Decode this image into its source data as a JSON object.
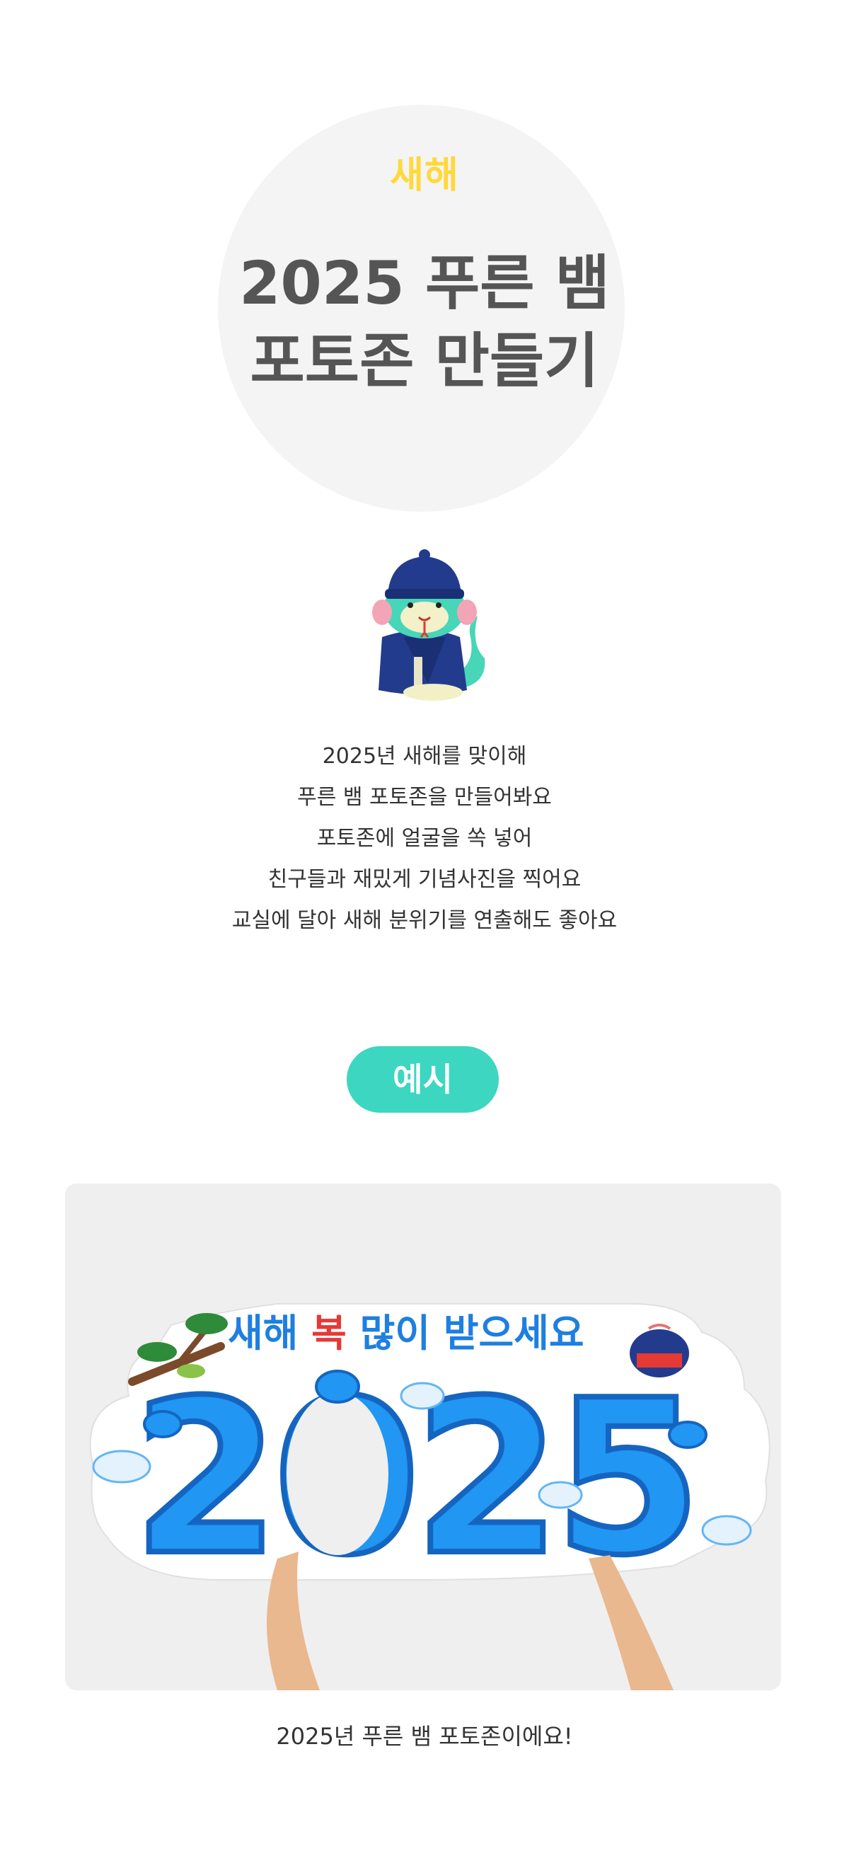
{
  "hero": {
    "eyebrow": "새해",
    "title_line1": "2025 푸른 뱀",
    "title_line2": "포토존 만들기"
  },
  "description": {
    "lines": [
      "2025년 새해를 맞이해",
      "푸른 뱀 포토존을 만들어봐요",
      "포토존에 얼굴을 쏙 넣어",
      "친구들과 재밌게 기념사진을 찍어요",
      "교실에 달아 새해 분위기를 연출해도 좋아요"
    ]
  },
  "example": {
    "pill_label": "예시"
  },
  "photo": {
    "banner_text_a": "새해 ",
    "banner_text_b": "복",
    "banner_text_c": " 많이 받으세요",
    "year": "2025",
    "caption": "2025년 푸른 뱀 포토존이에요!"
  },
  "colors": {
    "eyebrow": "#ffd83b",
    "title": "#555555",
    "pill": "#3dd6c1",
    "snake_blue": "#1e88e5",
    "banner_text": "#1e7fe0",
    "banner_red": "#e53935"
  }
}
